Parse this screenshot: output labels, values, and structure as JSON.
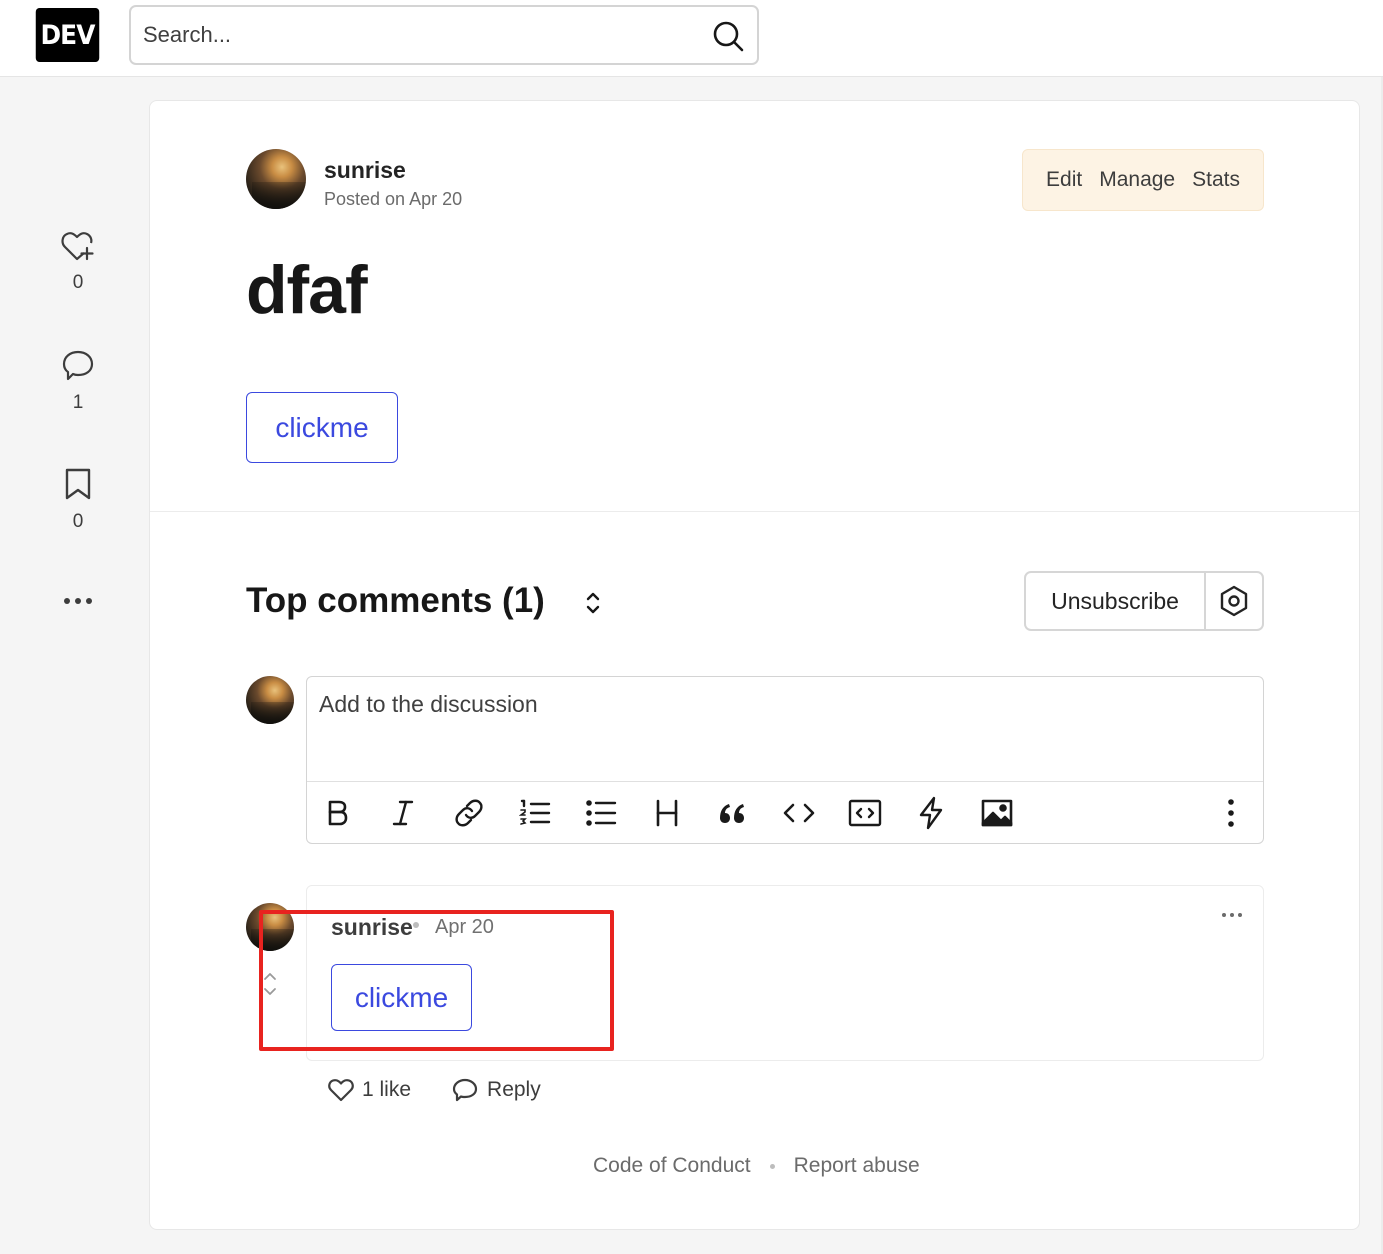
{
  "header": {
    "logo_text": "DEV",
    "search_placeholder": "Search..."
  },
  "reactions": {
    "likes": "0",
    "comments": "1",
    "bookmarks": "0"
  },
  "post": {
    "author": "sunrise",
    "posted": "Posted on Apr 20",
    "title": "dfaf",
    "button_label": "clickme",
    "owner_actions": [
      "Edit",
      "Manage",
      "Stats"
    ]
  },
  "comments_section": {
    "title": "Top comments (1)",
    "unsubscribe_label": "Unsubscribe",
    "editor_placeholder": "Add to the discussion"
  },
  "comment": {
    "author": "sunrise",
    "date": "Apr 20",
    "button_label": "clickme",
    "likes_label": "1 like",
    "reply_label": "Reply"
  },
  "footer": {
    "code_of_conduct": "Code of Conduct",
    "report_abuse": "Report abuse"
  },
  "colors": {
    "accent": "#3b49df",
    "highlight": "#e8231f",
    "owner_bg": "#fdf3e4"
  }
}
